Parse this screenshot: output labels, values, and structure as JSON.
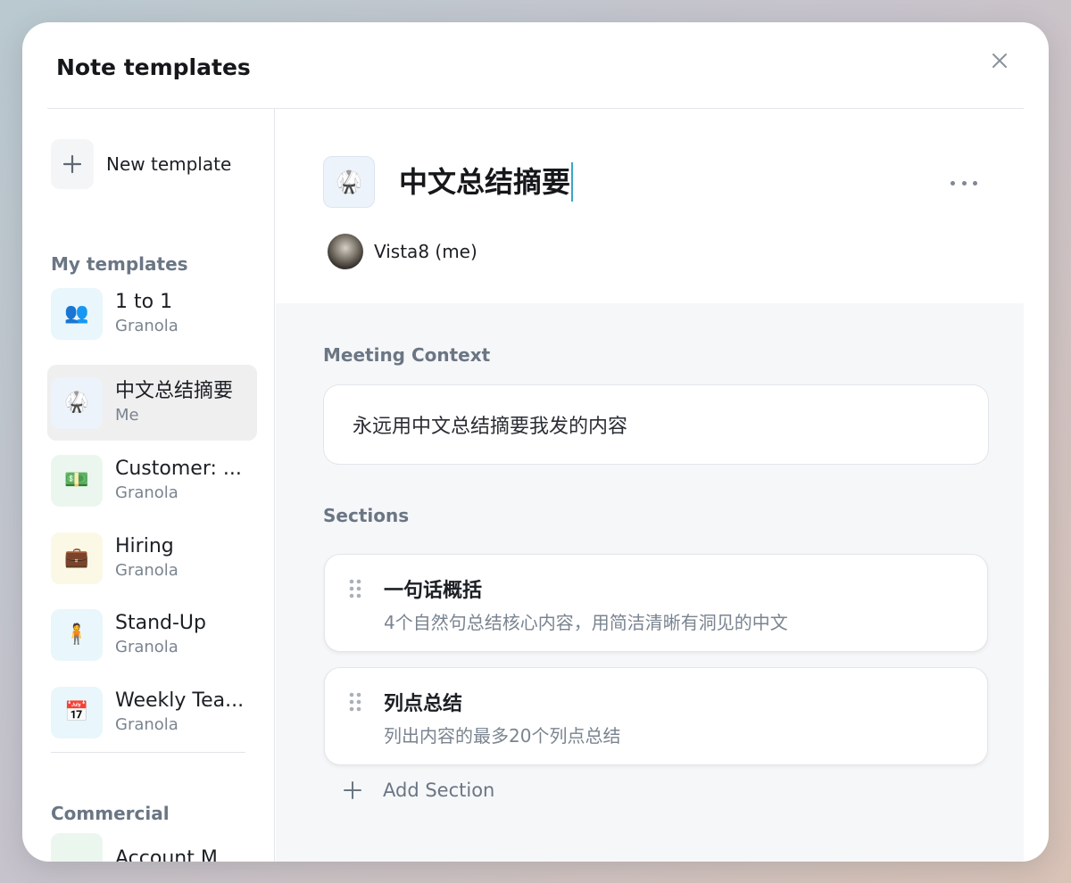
{
  "modal": {
    "title": "Note templates"
  },
  "sidebar": {
    "new_template_label": "New template",
    "my_templates_label": "My templates",
    "commercial_label": "Commercial",
    "items": [
      {
        "name": "1 to 1",
        "author": "Granola",
        "icon": "people-icon",
        "icon_char": "👥",
        "icon_bg": "#e9f6fb"
      },
      {
        "name": "中文总结摘要",
        "author": "Me",
        "icon": "karate-uniform-icon",
        "icon_char": "🥋",
        "icon_bg": "#edf3fb",
        "active": true
      },
      {
        "name": "Customer: ...",
        "author": "Granola",
        "icon": "money-icon",
        "icon_char": "💵",
        "icon_bg": "#ebf7ee"
      },
      {
        "name": "Hiring",
        "author": "Granola",
        "icon": "briefcase-icon",
        "icon_char": "💼",
        "icon_bg": "#fbf8e6"
      },
      {
        "name": "Stand-Up",
        "author": "Granola",
        "icon": "standing-person-icon",
        "icon_char": "🧍",
        "icon_bg": "#e9f6fb"
      },
      {
        "name": "Weekly Tea...",
        "author": "Granola",
        "icon": "calendar-icon",
        "icon_char": "📅",
        "icon_bg": "#e9f6fb"
      }
    ],
    "partial_item": {
      "name": "Account M...",
      "icon_bg": "#ebf7ee"
    }
  },
  "template": {
    "title": "中文总结摘要",
    "icon": "karate-uniform-icon",
    "owner": "Vista8 (me)"
  },
  "meeting_context": {
    "label": "Meeting Context",
    "value": "永远用中文总结摘要我发的内容"
  },
  "sections": {
    "label": "Sections",
    "items": [
      {
        "title": "一句话概括",
        "description": "4个自然句总结核心内容，用简洁清晰有洞见的中文"
      },
      {
        "title": "列点总结",
        "description": "列出内容的最多20个列点总结"
      }
    ],
    "add_label": "Add Section"
  },
  "colors": {
    "accent_cursor": "#3aa6c9",
    "active_item_bg": "#efefef",
    "label_gray": "#6b7684"
  }
}
